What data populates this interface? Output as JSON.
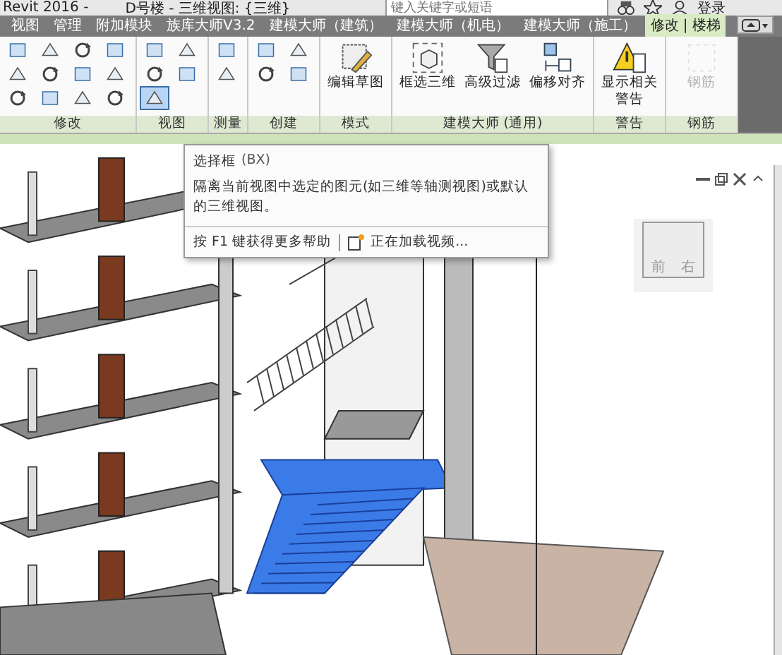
{
  "title_bar": {
    "app": "Revit 2016 -",
    "document": "D号楼 - 三维视图: {三维}",
    "search": {
      "placeholder": "键入关键字或短语"
    },
    "sign_in": "登录"
  },
  "tabs": [
    {
      "label": "视图",
      "selected": false
    },
    {
      "label": "管理",
      "selected": false
    },
    {
      "label": "附加模块",
      "selected": false
    },
    {
      "label": "族库大师V3.2",
      "selected": false
    },
    {
      "label": "建模大师（建筑）",
      "selected": false
    },
    {
      "label": "建模大师（机电）",
      "selected": false
    },
    {
      "label": "建模大师（施工）",
      "selected": false
    },
    {
      "label": "修改 | 楼梯",
      "selected": true
    }
  ],
  "ribbon": {
    "panels": [
      {
        "label": "修改",
        "kind": "modify"
      },
      {
        "label": "视图",
        "kind": "view"
      },
      {
        "label": "测量",
        "kind": "measure"
      },
      {
        "label": "创建",
        "kind": "create"
      },
      {
        "label": "模式",
        "kind": "mode",
        "buttons": [
          {
            "label": "编辑草图",
            "disabled": false
          }
        ]
      },
      {
        "label": "建模大师 (通用)",
        "kind": "modeling",
        "buttons": [
          {
            "label": "框选三维",
            "disabled": false
          },
          {
            "label": "高级过滤",
            "disabled": false
          },
          {
            "label": "偏移对齐",
            "disabled": false
          }
        ]
      },
      {
        "label": "警告",
        "kind": "warning",
        "buttons": [
          {
            "label": "显示相关警告",
            "disabled": false
          }
        ]
      },
      {
        "label": "钢筋",
        "kind": "rebar",
        "buttons": [
          {
            "label": "钢筋",
            "disabled": true
          }
        ]
      }
    ]
  },
  "tooltip": {
    "title": "选择框",
    "shortcut": "(BX)",
    "description": "隔离当前视图中选定的图元(如三维等轴测视图)或默认的三维视图。",
    "help": "按 F1 键获得更多帮助",
    "video": "正在加载视频..."
  },
  "viewcube": {
    "faces": [
      "前",
      "右"
    ]
  }
}
